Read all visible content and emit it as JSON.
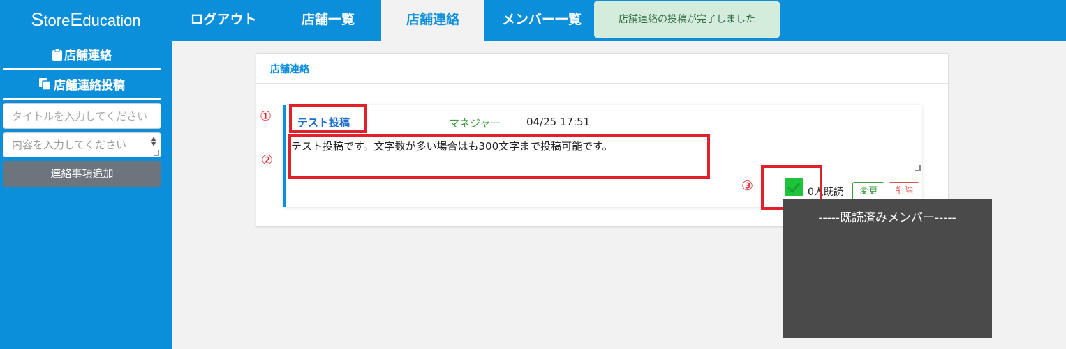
{
  "brand": {
    "cap1": "S",
    "rest1": "tore",
    "cap2": "E",
    "rest2": "ducation"
  },
  "nav": {
    "logout": "ログアウト",
    "stores": "店舗一覧",
    "contact": "店舗連絡",
    "members": "メンバー一覧"
  },
  "toast": {
    "message": "店舗連絡の投稿が完了しました"
  },
  "sidebar": {
    "heading1": "店舗連絡",
    "heading2": "店舗連絡投稿",
    "title_placeholder": "タイトルを入力してください",
    "content_placeholder": "内容を入力してください",
    "add_button": "連絡事項追加"
  },
  "card": {
    "title": "店舗連絡",
    "post": {
      "title": "テスト投稿",
      "role": "マネジャー",
      "date": "04/25 17:51",
      "body": "テスト投稿です。文字数が多い場合はも300文字まで投稿可能です。",
      "read_count": "0人既読",
      "edit_label": "変更",
      "delete_label": "削除"
    }
  },
  "annotations": {
    "n1": "①",
    "n2": "②",
    "n3": "③"
  },
  "popup": {
    "text": "-----既読済みメンバー-----"
  },
  "colors": {
    "primary": "#0b8fdb",
    "annotation": "#e0202b",
    "check": "#1ec23b"
  }
}
